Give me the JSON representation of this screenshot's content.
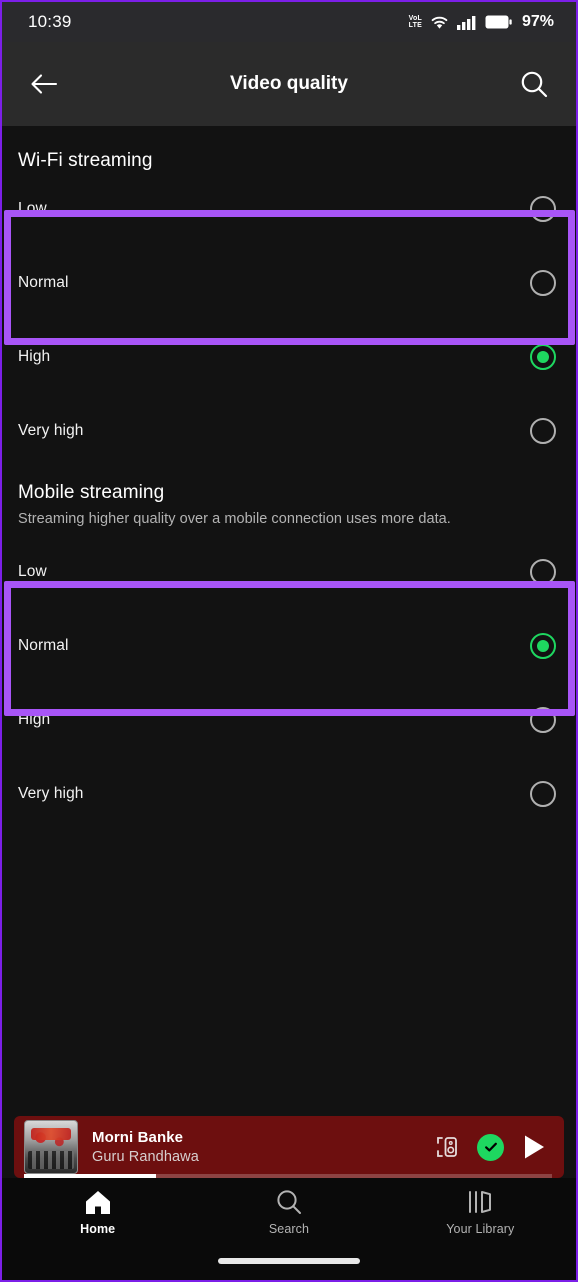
{
  "status_bar": {
    "time": "10:39",
    "network_type_top": "VoLTE",
    "network_type_line1": "VoL",
    "network_type_line2": "LTE",
    "battery_percent": "97%",
    "icons": [
      "volte-icon",
      "wifi-icon",
      "cellular-signal-icon",
      "battery-icon"
    ]
  },
  "header": {
    "title": "Video quality",
    "back_icon": "back-arrow-icon",
    "search_icon": "search-icon"
  },
  "sections": [
    {
      "id": "wifi",
      "title": "Wi-Fi streaming",
      "subtitle": "",
      "options": [
        {
          "label": "Low",
          "selected": false
        },
        {
          "label": "Normal",
          "selected": false
        },
        {
          "label": "High",
          "selected": true
        },
        {
          "label": "Very high",
          "selected": false
        }
      ]
    },
    {
      "id": "mobile",
      "title": "Mobile streaming",
      "subtitle": "Streaming higher quality over a mobile connection uses more data.",
      "options": [
        {
          "label": "Low",
          "selected": false
        },
        {
          "label": "Normal",
          "selected": true
        },
        {
          "label": "High",
          "selected": false
        },
        {
          "label": "Very high",
          "selected": false
        }
      ]
    }
  ],
  "annotations": {
    "color": "#a855f7",
    "boxes": [
      {
        "name": "wifi-low-normal-highlight",
        "section": "wifi",
        "covers": [
          "Low",
          "Normal"
        ]
      },
      {
        "name": "mobile-low-normal-highlight",
        "section": "mobile",
        "covers": [
          "Low",
          "Normal"
        ]
      }
    ]
  },
  "now_playing": {
    "track_title": "Morni Banke",
    "artist": "Guru Randhawa",
    "album_art": "album-art-thumbnail",
    "connect_icon": "connect-to-device-icon",
    "save_icon": "checkmark-circle-icon",
    "play_icon": "play-icon",
    "progress_percent": 25,
    "background_color": "#6d0f0f",
    "accent_color": "#1ed760"
  },
  "bottom_nav": {
    "items": [
      {
        "label": "Home",
        "icon": "home-icon",
        "active": true
      },
      {
        "label": "Search",
        "icon": "search-icon",
        "active": false
      },
      {
        "label": "Your Library",
        "icon": "library-icon",
        "active": false
      }
    ]
  },
  "colors": {
    "background": "#121212",
    "header_background": "#2b2b2b",
    "status_background": "#2a2a2d",
    "accent_green": "#1ed760",
    "annotation_purple": "#a855f7",
    "radio_unselected": "#b0b0b0"
  }
}
